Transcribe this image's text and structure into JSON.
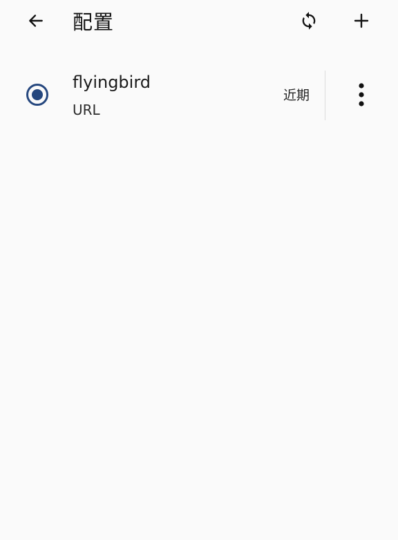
{
  "header": {
    "title": "配置",
    "back_icon": "arrow-left-icon",
    "refresh_icon": "sync-icon",
    "add_icon": "plus-icon"
  },
  "profiles": [
    {
      "name": "flyingbird",
      "type": "URL",
      "updated": "近期",
      "selected": true,
      "more_icon": "more-vertical-icon"
    }
  ],
  "colors": {
    "accent": "#25477e",
    "background": "#fafafa"
  }
}
